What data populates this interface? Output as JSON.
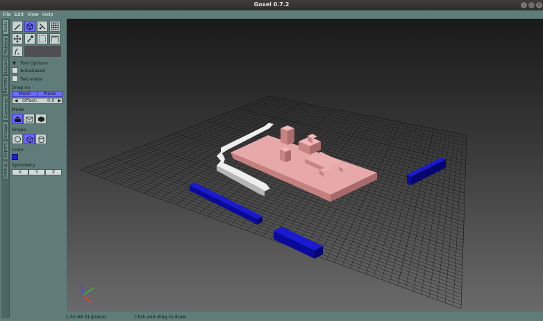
{
  "window": {
    "title": "Goxel 0.7.2",
    "min_icon": "minimize-icon",
    "max_icon": "maximize-icon",
    "close_icon": "close-icon"
  },
  "menu": [
    "File",
    "Edit",
    "View",
    "Help"
  ],
  "side_tabs": [
    {
      "label": "Tools",
      "active": true
    },
    {
      "label": "Palette",
      "active": false
    },
    {
      "label": "Layers",
      "active": false
    },
    {
      "label": "Render",
      "active": false
    },
    {
      "label": "Cameras",
      "active": false
    },
    {
      "label": "Image",
      "active": false
    },
    {
      "label": "Export",
      "active": false
    },
    {
      "label": "Debug",
      "active": false
    }
  ],
  "tools": [
    {
      "name": "brush",
      "icon": "pencil-icon",
      "active": false
    },
    {
      "name": "shape",
      "icon": "cube-icon",
      "active": true
    },
    {
      "name": "laser",
      "icon": "laser-icon",
      "active": false
    },
    {
      "name": "plane",
      "icon": "grid-icon",
      "active": false
    },
    {
      "name": "move",
      "icon": "move-icon",
      "active": false
    },
    {
      "name": "pick-color",
      "icon": "eyedropper-icon",
      "active": false
    },
    {
      "name": "selection",
      "icon": "selection-icon",
      "active": false
    },
    {
      "name": "fuzzy-select",
      "icon": "measure-icon",
      "active": false
    },
    {
      "name": "procedural",
      "icon": "function-icon",
      "active": false
    }
  ],
  "tool_options": {
    "header": "Tool Options",
    "header_icon": "triangle-down-icon",
    "antialiased": {
      "label": "Antialiased",
      "checked": false
    },
    "two_steps": {
      "label": "Two steps",
      "checked": false
    }
  },
  "snap": {
    "label": "Snap on",
    "mesh": "Mesh",
    "plane": "Plane",
    "offset_label": "Offset:",
    "offset_value": "0.0",
    "left_arrow": "◀",
    "right_arrow": "▶"
  },
  "mode": {
    "label": "Mode",
    "options": [
      {
        "icon": "mode-add-icon",
        "active": true
      },
      {
        "icon": "mode-sub-icon",
        "active": false
      },
      {
        "icon": "mode-paint-icon",
        "active": false
      }
    ]
  },
  "shape": {
    "label": "Shape",
    "options": [
      {
        "icon": "sphere-icon",
        "active": false
      },
      {
        "icon": "cube-shape-icon",
        "active": true
      },
      {
        "icon": "cylinder-icon",
        "active": false
      }
    ]
  },
  "color": {
    "label": "Color",
    "value": "#1e20d8"
  },
  "symmetry": {
    "label": "Symmetry",
    "x": "X",
    "y": "Y",
    "z": "Z"
  },
  "status": {
    "position": "[-50 66 0] (plane)",
    "hint": "Click and drag to draw."
  },
  "colors": {
    "accent": "#6e6cf2",
    "panel": "#5f7c78",
    "voxel_pink": "#e8a6a6",
    "voxel_blue": "#0d0db0"
  }
}
